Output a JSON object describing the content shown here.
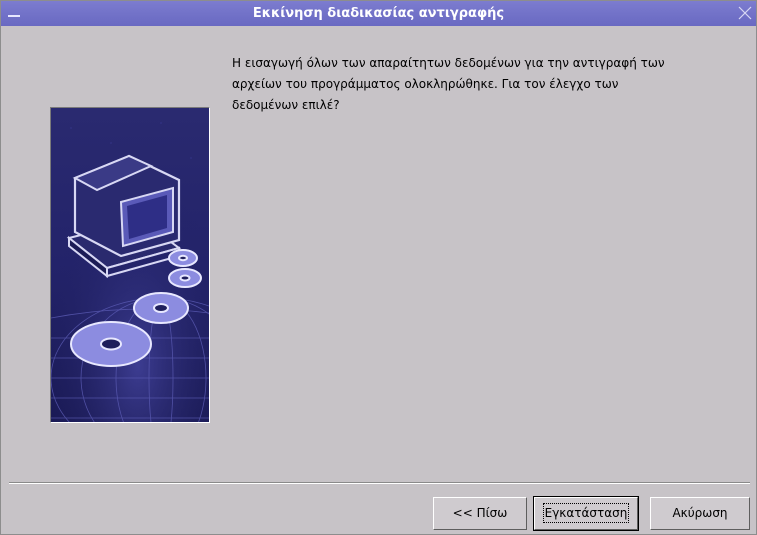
{
  "window": {
    "title": "Εκκίνηση διαδικασίας αντιγραφής"
  },
  "message": "Η εισαγωγή όλων των απαραίτητων δεδομένων για την αντιγραφή των\nαρχείων του προγράμματος ολοκληρώθηκε. Για τον έλεγχο των\nδεδομένων επιλέ?",
  "buttons": {
    "back": "<< Πίσω",
    "install": "Εγκατάσταση",
    "cancel": "Ακύρωση"
  },
  "icons": {
    "window_menu": "window-menu-icon",
    "close": "close-icon",
    "side_image": "computer-with-discs-illustration"
  },
  "colors": {
    "titlebar": "#6e6ec6",
    "background": "#c7c3c7",
    "panel": "#1f1f5c",
    "disc": "#8c8ce0"
  }
}
